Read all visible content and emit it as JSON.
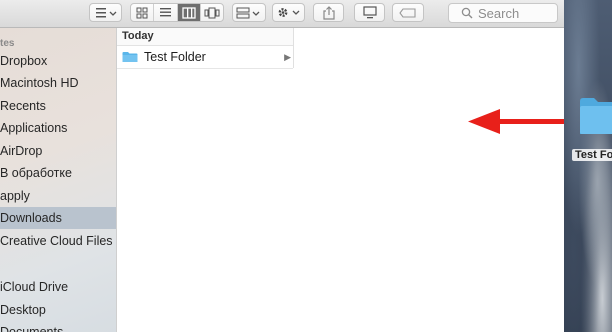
{
  "toolbar": {
    "search_placeholder": "Search"
  },
  "sidebar": {
    "section_favorites": "tes",
    "items": [
      {
        "label": "Dropbox"
      },
      {
        "label": "Macintosh HD"
      },
      {
        "label": "Recents"
      },
      {
        "label": "Applications"
      },
      {
        "label": "AirDrop"
      },
      {
        "label": "В обработке"
      },
      {
        "label": "apply"
      },
      {
        "label": "Downloads",
        "selected": true
      },
      {
        "label": "Creative Cloud Files"
      }
    ],
    "section_icloud": "",
    "icloud_items": [
      {
        "label": "iCloud Drive"
      },
      {
        "label": "Desktop"
      },
      {
        "label": "Documents"
      }
    ]
  },
  "column": {
    "header": "Today",
    "rows": [
      {
        "name": "Test Folder"
      }
    ]
  },
  "desktop": {
    "folder_label": "Test Fo"
  },
  "colors": {
    "arrow": "#e8201a",
    "folder": "#5ab6ea",
    "selected_row": "#b9c3ce"
  }
}
